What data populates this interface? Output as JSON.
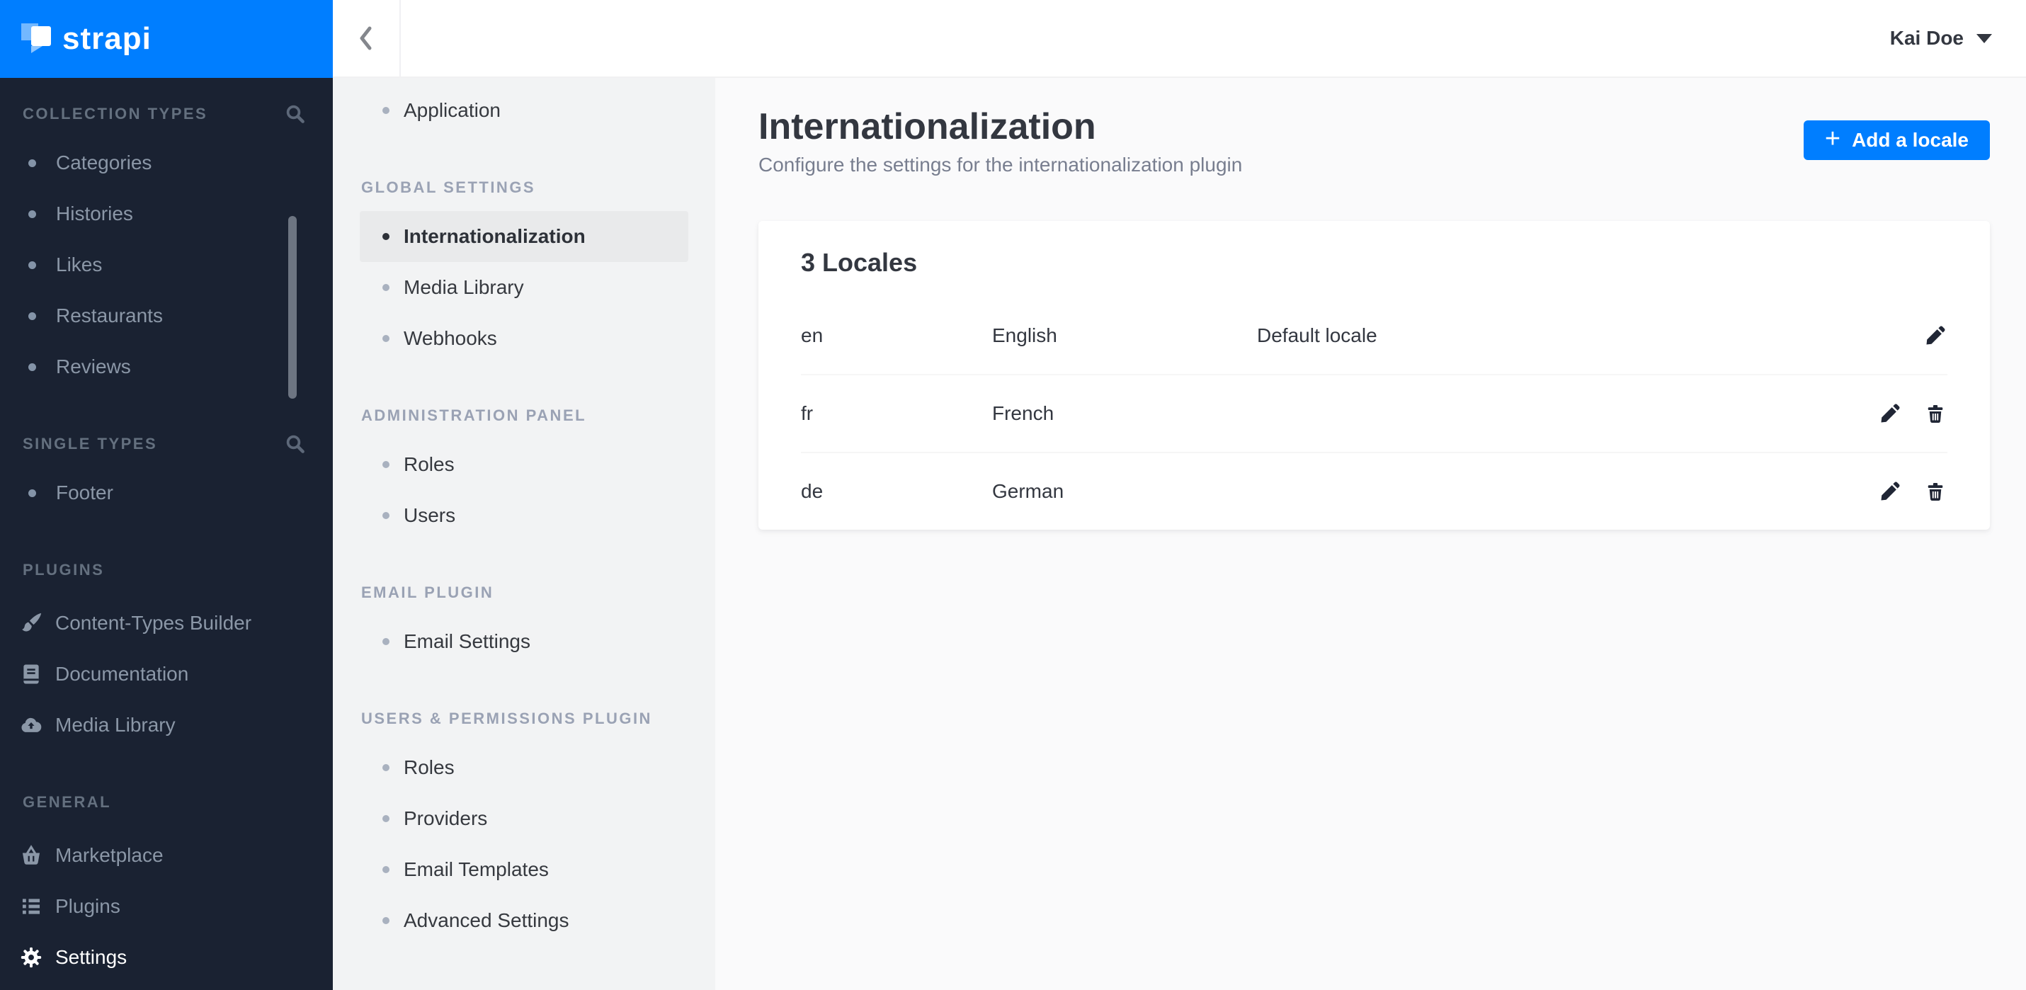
{
  "brand": {
    "name": "strapi"
  },
  "colors": {
    "accent": "#007eff",
    "sidebar_bg": "#1a2232",
    "sidebar_text": "#8b97a7",
    "settings_nav_bg": "#f2f3f4",
    "active_item_bg": "#e9eaeb",
    "content_bg": "#fafafb",
    "text_dark": "#333740",
    "text_muted": "#787e8f"
  },
  "icons": {
    "back": "chevron-left-icon",
    "user_menu": "caret-down-icon",
    "search": "search-icon",
    "content_types_builder": "paintbrush-icon",
    "documentation": "book-icon",
    "media_library": "cloud-upload-icon",
    "marketplace": "basket-icon",
    "plugins": "list-icon",
    "settings": "gear-icon",
    "add": "plus-icon",
    "edit": "pencil-icon",
    "delete": "trash-icon"
  },
  "topbar": {
    "user": {
      "name": "Kai Doe"
    }
  },
  "sidebar": {
    "sections": [
      {
        "label": "COLLECTION TYPES",
        "items": [
          {
            "label": "Categories"
          },
          {
            "label": "Histories"
          },
          {
            "label": "Likes"
          },
          {
            "label": "Restaurants"
          },
          {
            "label": "Reviews"
          }
        ]
      },
      {
        "label": "SINGLE TYPES",
        "items": [
          {
            "label": "Footer"
          }
        ]
      },
      {
        "label": "PLUGINS",
        "items": [
          {
            "label": "Content-Types Builder"
          },
          {
            "label": "Documentation"
          },
          {
            "label": "Media Library"
          }
        ]
      },
      {
        "label": "GENERAL",
        "items": [
          {
            "label": "Marketplace"
          },
          {
            "label": "Plugins"
          },
          {
            "label": "Settings"
          }
        ]
      }
    ]
  },
  "settings_nav": {
    "standalone": {
      "label": "Application"
    },
    "sections": [
      {
        "label": "GLOBAL SETTINGS",
        "items": [
          {
            "label": "Internationalization"
          },
          {
            "label": "Media Library"
          },
          {
            "label": "Webhooks"
          }
        ]
      },
      {
        "label": "ADMINISTRATION PANEL",
        "items": [
          {
            "label": "Roles"
          },
          {
            "label": "Users"
          }
        ]
      },
      {
        "label": "EMAIL PLUGIN",
        "items": [
          {
            "label": "Email Settings"
          }
        ]
      },
      {
        "label": "USERS & PERMISSIONS PLUGIN",
        "items": [
          {
            "label": "Roles"
          },
          {
            "label": "Providers"
          },
          {
            "label": "Email Templates"
          },
          {
            "label": "Advanced Settings"
          }
        ]
      }
    ]
  },
  "page": {
    "title": "Internationalization",
    "subtitle": "Configure the settings for the internationalization plugin",
    "add_button": {
      "plus": "+",
      "label": "Add a locale"
    }
  },
  "locales": {
    "title": "3 Locales",
    "rows": [
      {
        "code": "en",
        "name": "English",
        "note": "Default locale"
      },
      {
        "code": "fr",
        "name": "French",
        "note": ""
      },
      {
        "code": "de",
        "name": "German",
        "note": ""
      }
    ]
  }
}
